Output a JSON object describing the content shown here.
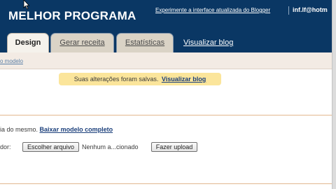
{
  "header": {
    "blog_title": "MELHOR PROGRAMA",
    "top_link": "Experimente a interface atualizada do Blogger",
    "user": "inf.lf@hotm"
  },
  "tabs": [
    {
      "label": "Design",
      "active": true
    },
    {
      "label": "Gerar receita",
      "active": false
    },
    {
      "label": "Estatísticas",
      "active": false
    }
  ],
  "view_blog_link": "Visualizar blog",
  "subnav": {
    "link": "o modelo"
  },
  "notice": {
    "text": "Suas alterações foram salvas.",
    "link": "Visualizar blog"
  },
  "backup": {
    "text": "ia do mesmo.",
    "link": "Baixar modelo completo"
  },
  "upload": {
    "label": "dor:",
    "choose_button": "Escolher arquivo",
    "file_status": "Nenhum a...cionado",
    "upload_button": "Fazer upload"
  },
  "colors": {
    "header_bg": "#0a3764",
    "notice_bg": "#fbe59b",
    "link_color": "#1b3f7b",
    "divider": "#e2b78f"
  }
}
